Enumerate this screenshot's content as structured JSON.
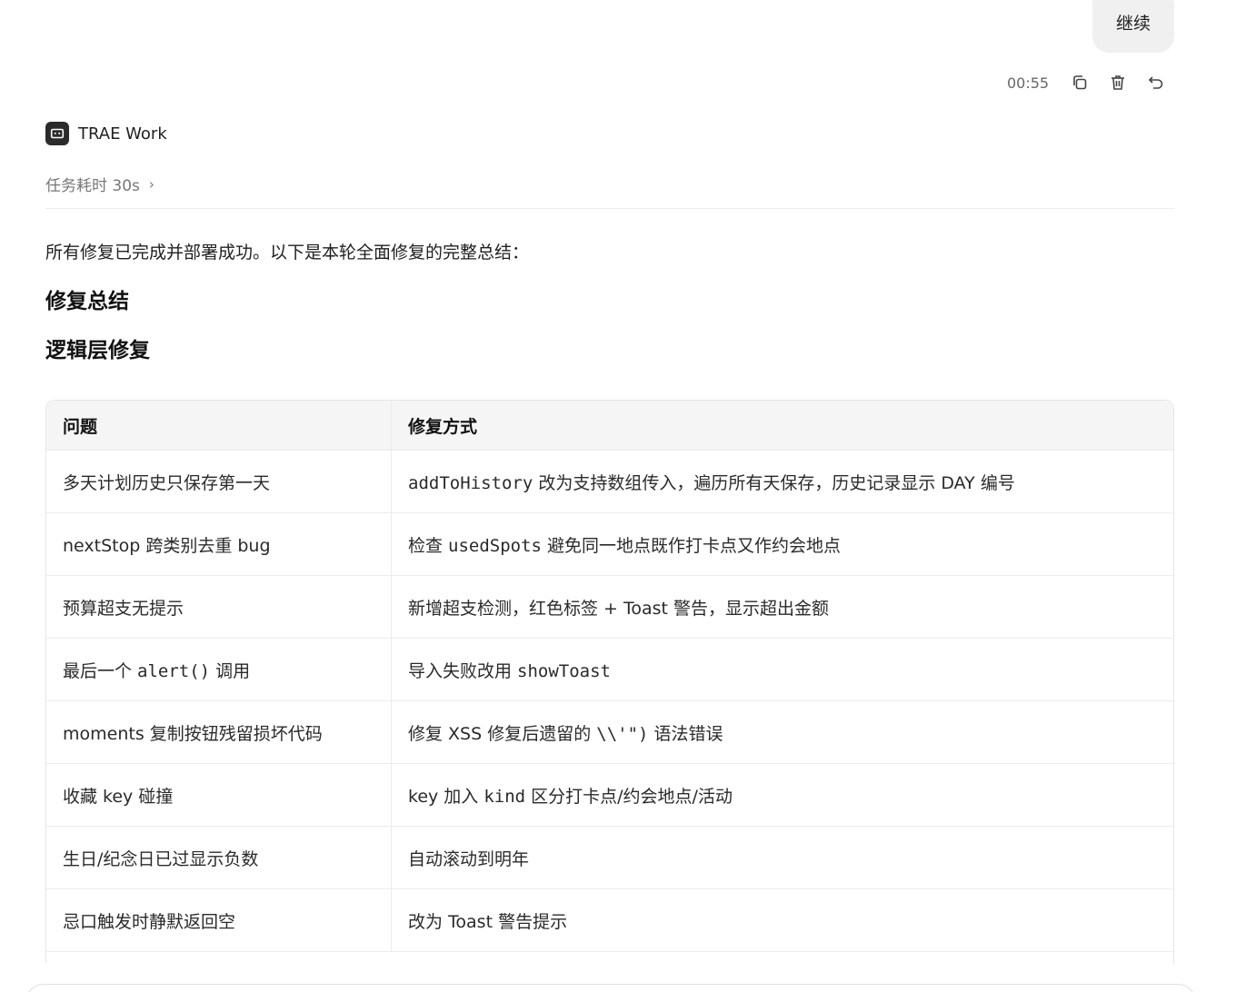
{
  "user_message": {
    "text": "继续"
  },
  "message_meta": {
    "time": "00:55"
  },
  "agent": {
    "name": "TRAE Work"
  },
  "task": {
    "duration": "任务耗时 30s",
    "chevron": "›"
  },
  "content": {
    "intro": "所有修复已完成并部署成功。以下是本轮全面修复的完整总结：",
    "heading_summary": "修复总结",
    "heading_logic": "逻辑层修复"
  },
  "table": {
    "headers": [
      "问题",
      "修复方式"
    ],
    "rows": [
      {
        "issue": [
          {
            "t": "多天计划历史只保存第一天"
          }
        ],
        "fix": [
          {
            "c": "addToHistory"
          },
          {
            "t": " 改为支持数组传入，遍历所有天保存，历史记录显示 DAY 编号"
          }
        ]
      },
      {
        "issue": [
          {
            "t": "nextStop 跨类别去重 bug"
          }
        ],
        "fix": [
          {
            "t": "检查 "
          },
          {
            "c": "usedSpots"
          },
          {
            "t": " 避免同一地点既作打卡点又作约会地点"
          }
        ]
      },
      {
        "issue": [
          {
            "t": "预算超支无提示"
          }
        ],
        "fix": [
          {
            "t": "新增超支检测，红色标签 + Toast 警告，显示超出金额"
          }
        ]
      },
      {
        "issue": [
          {
            "t": "最后一个 "
          },
          {
            "c": "alert()"
          },
          {
            "t": " 调用"
          }
        ],
        "fix": [
          {
            "t": "导入失败改用 "
          },
          {
            "c": "showToast"
          }
        ]
      },
      {
        "issue": [
          {
            "t": "moments 复制按钮残留损坏代码"
          }
        ],
        "fix": [
          {
            "t": "修复 XSS 修复后遗留的 "
          },
          {
            "c": "\\\\'\")"
          },
          {
            "t": " 语法错误"
          }
        ]
      },
      {
        "issue": [
          {
            "t": "收藏 key 碰撞"
          }
        ],
        "fix": [
          {
            "t": "key 加入 "
          },
          {
            "c": "kind"
          },
          {
            "t": " 区分打卡点/约会地点/活动"
          }
        ]
      },
      {
        "issue": [
          {
            "t": "生日/纪念日已过显示负数"
          }
        ],
        "fix": [
          {
            "t": "自动滚动到明年"
          }
        ]
      },
      {
        "issue": [
          {
            "t": "忌口触发时静默返回空"
          }
        ],
        "fix": [
          {
            "t": "改为 Toast 警告提示"
          }
        ]
      }
    ]
  },
  "icons": {
    "copy": "copy-icon",
    "delete": "trash-icon",
    "undo": "undo-icon",
    "agent_logo": "trae-logo-icon"
  }
}
